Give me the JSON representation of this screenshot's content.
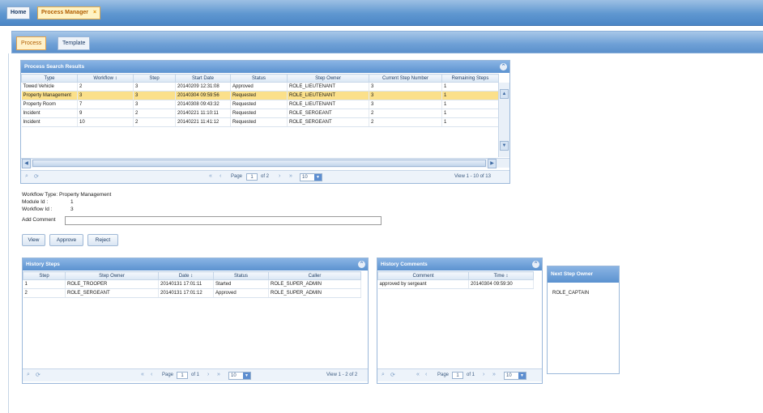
{
  "top_tabs": {
    "home": "Home",
    "active": "Process Manager",
    "close": "×"
  },
  "sub_tabs": {
    "process": "Process",
    "template": "Template"
  },
  "search_results": {
    "title": "Process Search Results",
    "columns": [
      "Type",
      "Workflow ↕",
      "Step",
      "Start Date",
      "Status",
      "Step Owner",
      "Current Step Number",
      "Remaining Steps"
    ],
    "rows": [
      [
        "Towed Vehicle",
        "2",
        "3",
        "20140209 12:31:08",
        "Approved",
        "ROLE_LIEUTENANT",
        "3",
        "1"
      ],
      [
        "Property Management",
        "3",
        "3",
        "20140304 09:59:56",
        "Requested",
        "ROLE_LIEUTENANT",
        "3",
        "1"
      ],
      [
        "Property Room",
        "7",
        "3",
        "20140308 09:43:32",
        "Requested",
        "ROLE_LIEUTENANT",
        "3",
        "1"
      ],
      [
        "Incident",
        "9",
        "2",
        "20140221 11:10:11",
        "Requested",
        "ROLE_SERGEANT",
        "2",
        "1"
      ],
      [
        "Incident",
        "10",
        "2",
        "20140221 11:41:12",
        "Requested",
        "ROLE_SERGEANT",
        "2",
        "1"
      ]
    ],
    "pager": {
      "page_label": "Page",
      "page": "1",
      "of": "of 2",
      "per_page": "10",
      "view": "View 1 - 10 of 13"
    }
  },
  "details": {
    "workflow_type": "Workflow Type: Property Management",
    "module_id": "Module Id :",
    "module_id_value": "1",
    "workflow_id": "Workflow Id :",
    "workflow_id_value": "3",
    "add_comment": "Add Comment",
    "comment_value": ""
  },
  "buttons": {
    "view": "View",
    "approve": "Approve",
    "reject": "Reject"
  },
  "history": {
    "title": "History Steps",
    "columns": [
      "Step",
      "Step Owner",
      "Date ↕",
      "Status",
      "Caller"
    ],
    "rows": [
      [
        "1",
        "ROLE_TROOPER",
        "20140131 17:01:11",
        "Started",
        "ROLE_SUPER_ADMIN"
      ],
      [
        "2",
        "ROLE_SERGEANT",
        "20140131 17:01:12",
        "Approved",
        "ROLE_SUPER_ADMIN"
      ]
    ],
    "pager": {
      "page_label": "Page",
      "page": "1",
      "of": "of 1",
      "per_page": "10",
      "view": "View 1 - 2 of 2"
    }
  },
  "comments": {
    "title": "History Comments",
    "columns": [
      "Comment",
      "Time ↕"
    ],
    "rows": [
      [
        "approved by sergeant",
        "20140304 09:59:30"
      ]
    ],
    "pager": {
      "page_label": "Page",
      "page": "1",
      "of": "of 1",
      "per_page": "10"
    }
  },
  "next_owner": {
    "title": "Next Step Owner",
    "value": "ROLE_CAPTAIN"
  },
  "icons": {
    "refresh": "⟳",
    "search": "⌕",
    "first": "«",
    "prev": "‹",
    "next": "›",
    "last": "»",
    "up": "▲",
    "down": "▼",
    "left": "◀",
    "right": "▶",
    "dropdown": "▼",
    "collapse": "⌃"
  }
}
